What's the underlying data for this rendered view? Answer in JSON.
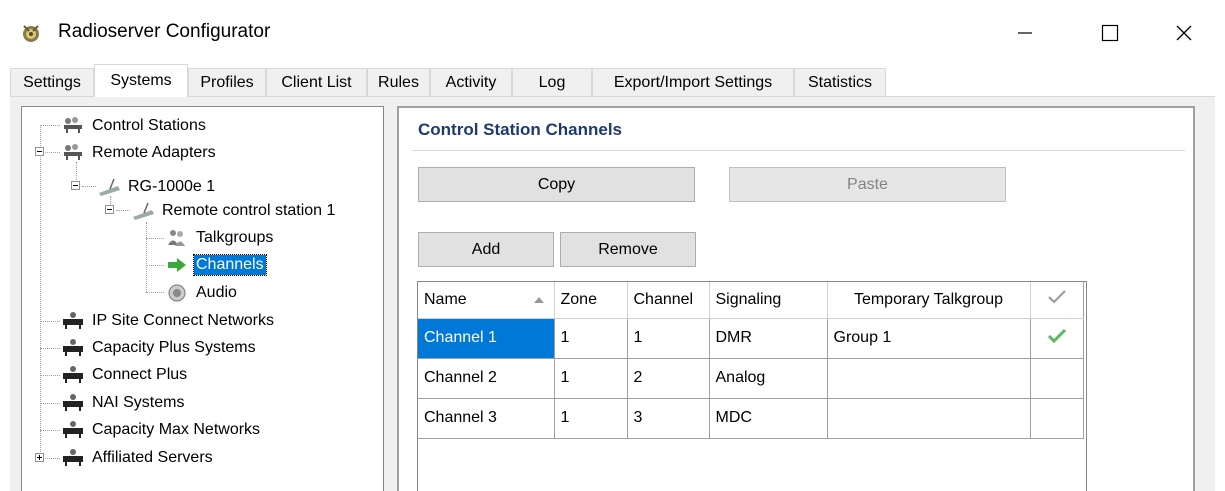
{
  "window": {
    "title": "Radioserver Configurator"
  },
  "tabs": [
    "Settings",
    "Systems",
    "Profiles",
    "Client List",
    "Rules",
    "Activity",
    "Log",
    "Export/Import Settings",
    "Statistics"
  ],
  "active_tab": "Systems",
  "tree": {
    "items": [
      {
        "label": "Control Stations",
        "icon": "network-nodes-icon"
      },
      {
        "label": "Remote Adapters",
        "icon": "network-nodes-icon"
      },
      {
        "label": "RG-1000e 1",
        "icon": "antenna-icon"
      },
      {
        "label": "Remote control station 1",
        "icon": "antenna-icon"
      },
      {
        "label": "Talkgroups",
        "icon": "group-icon"
      },
      {
        "label": "Channels",
        "icon": "green-arrow-icon",
        "selected": true
      },
      {
        "label": "Audio",
        "icon": "speaker-icon"
      },
      {
        "label": "IP Site Connect Networks",
        "icon": "network-icon"
      },
      {
        "label": "Capacity Plus Systems",
        "icon": "network-icon"
      },
      {
        "label": "Connect Plus",
        "icon": "network-icon"
      },
      {
        "label": "NAI Systems",
        "icon": "network-icon"
      },
      {
        "label": "Capacity Max Networks",
        "icon": "network-icon"
      },
      {
        "label": "Affiliated Servers",
        "icon": "network-icon"
      }
    ]
  },
  "panel": {
    "title": "Control Station Channels",
    "copy_label": "Copy",
    "paste_label": "Paste",
    "add_label": "Add",
    "remove_label": "Remove"
  },
  "grid": {
    "columns": [
      "Name",
      "Zone",
      "Channel",
      "Signaling",
      "Temporary Talkgroup"
    ],
    "check_header_icon": "checkmark-outline-icon",
    "sort_indicator_icon": "sort-ascending-icon",
    "rows": [
      {
        "name": "Channel 1",
        "zone": "1",
        "channel": "1",
        "signaling": "DMR",
        "temporary_talkgroup": "Group 1",
        "checked": true
      },
      {
        "name": "Channel 2",
        "zone": "1",
        "channel": "2",
        "signaling": "Analog",
        "temporary_talkgroup": "",
        "checked": false
      },
      {
        "name": "Channel 3",
        "zone": "1",
        "channel": "3",
        "signaling": "MDC",
        "temporary_talkgroup": "",
        "checked": false
      }
    ]
  },
  "colors": {
    "selection": "#0078d7",
    "section_title": "#1e3a6e",
    "check_green": "#5cb85c"
  }
}
